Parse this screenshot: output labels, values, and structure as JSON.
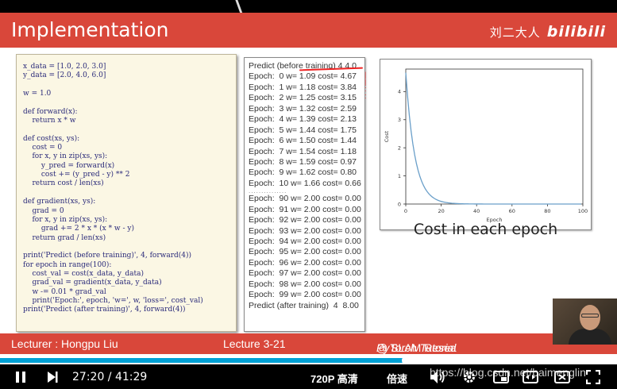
{
  "slide": {
    "title": "Implementation",
    "brand_cn": "刘二大人",
    "brand_logo": "bilibili",
    "accent_color": "#d9473a"
  },
  "code": [
    "x_data = [1.0, 2.0, 3.0]",
    "y_data = [2.0, 4.0, 6.0]",
    "",
    "w = 1.0",
    "",
    "def forward(x):",
    "    return x * w",
    "",
    "def cost(xs, ys):",
    "    cost = 0",
    "    for x, y in zip(xs, ys):",
    "        y_pred = forward(x)",
    "        cost += (y_pred - y) ** 2",
    "    return cost / len(xs)",
    "",
    "def gradient(xs, ys):",
    "    grad = 0",
    "    for x, y in zip(xs, ys):",
    "        grad += 2 * x * (x * w - y)",
    "    return grad / len(xs)",
    "",
    "print('Predict (before training)', 4, forward(4))",
    "for epoch in range(100):",
    "    cost_val = cost(x_data, y_data)",
    "    grad_val = gradient(x_data, y_data)",
    "    w -= 0.01 * grad_val",
    "    print('Epoch:', epoch, 'w=', w, 'loss=', cost_val)",
    "print('Predict (after training)', 4, forward(4))"
  ],
  "output": {
    "before": "Predict (before training) 4 4.0",
    "first": [
      "Epoch:  0 w= 1.09 cost= 4.67",
      "Epoch:  1 w= 1.18 cost= 3.84",
      "Epoch:  2 w= 1.25 cost= 3.15",
      "Epoch:  3 w= 1.32 cost= 2.59",
      "Epoch:  4 w= 1.39 cost= 2.13",
      "Epoch:  5 w= 1.44 cost= 1.75",
      "Epoch:  6 w= 1.50 cost= 1.44",
      "Epoch:  7 w= 1.54 cost= 1.18",
      "Epoch:  8 w= 1.59 cost= 0.97",
      "Epoch:  9 w= 1.62 cost= 0.80",
      "Epoch:  10 w= 1.66 cost= 0.66"
    ],
    "separator": "...............",
    "last": [
      "Epoch:  90 w= 2.00 cost= 0.00",
      "Epoch:  91 w= 2.00 cost= 0.00",
      "Epoch:  92 w= 2.00 cost= 0.00",
      "Epoch:  93 w= 2.00 cost= 0.00",
      "Epoch:  94 w= 2.00 cost= 0.00",
      "Epoch:  95 w= 2.00 cost= 0.00",
      "Epoch:  96 w= 2.00 cost= 0.00",
      "Epoch:  97 w= 2.00 cost= 0.00",
      "Epoch:  98 w= 2.00 cost= 0.00",
      "Epoch:  99 w= 2.00 cost= 0.00"
    ],
    "after": "Predict (after training)  4  8.00",
    "annotation_marks": "|\n|\n:\n:"
  },
  "chart_data": {
    "type": "line",
    "xlabel": "Epoch",
    "ylabel": "Cost",
    "xlim": [
      0,
      100
    ],
    "ylim": [
      0,
      4.8
    ],
    "xticks": [
      0,
      20,
      40,
      60,
      80,
      100
    ],
    "yticks": [
      0,
      1,
      2,
      3,
      4
    ],
    "line_color": "#6a9fc9",
    "grid": false,
    "cost_model": {
      "initial": 4.67,
      "decay_per_epoch": 0.8224
    },
    "epochs": 100
  },
  "chart_caption": "Cost in each epoch",
  "footer": {
    "lecturer": "Lecturer : Hongpu Liu",
    "lecture": "Lecture 3-21",
    "series_italic": "PyTorch Tutorial",
    "series_rest": " @ SLAM Resea"
  },
  "player": {
    "current_time": "27:20",
    "separator": " / ",
    "total_time": "41:29",
    "progress_fraction": 0.659,
    "quality": "720P 高清",
    "speed": "倍速",
    "watermark": "https://blog.csdn.net/baimenglin",
    "progress_color": "#00a1d6"
  }
}
